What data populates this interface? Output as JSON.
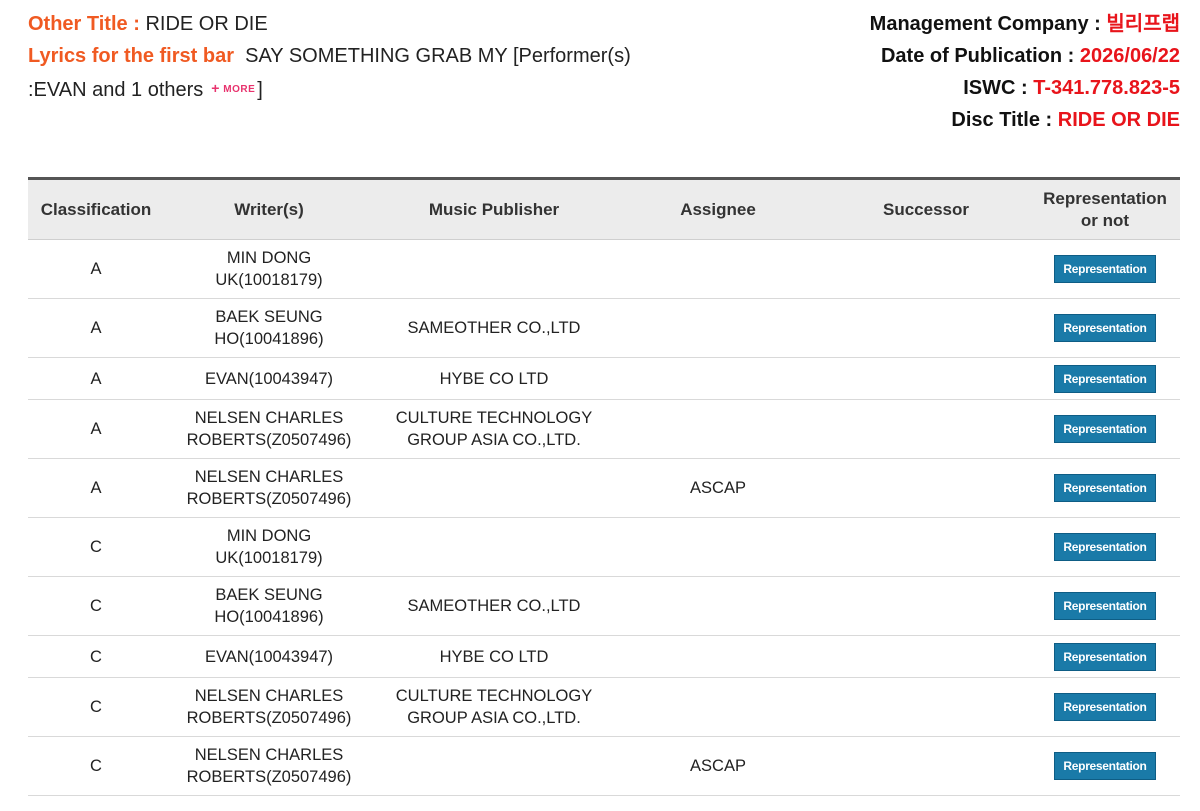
{
  "info": {
    "other_title_label": "Other Title :",
    "other_title_value": "RIDE OR DIE",
    "lyrics_label": "Lyrics for the first bar",
    "lyrics_value": "SAY SOMETHING GRAB MY [Performer(s)",
    "performers_value": ":EVAN and 1 others",
    "more_label": "MORE",
    "performers_close": "]"
  },
  "meta": {
    "management_label": "Management Company :",
    "management_value": "빌리프랩",
    "date_label": "Date of Publication :",
    "date_value": "2026/06/22",
    "iswc_label": "ISWC :",
    "iswc_value": "T-341.778.823-5",
    "disc_label": "Disc Title :",
    "disc_value": "RIDE OR DIE"
  },
  "table": {
    "headers": [
      "Classification",
      "Writer(s)",
      "Music Publisher",
      "Assignee",
      "Successor",
      "Representation or not"
    ],
    "rows": [
      {
        "classification": "A",
        "writer_line1": "MIN DONG",
        "writer_line2": "UK(10018179)",
        "publisher_line1": "",
        "publisher_line2": "",
        "assignee": "",
        "successor": "",
        "representation": "Representation"
      },
      {
        "classification": "A",
        "writer_line1": "BAEK SEUNG",
        "writer_line2": "HO(10041896)",
        "publisher_line1": "SAMEOTHER CO.,LTD",
        "publisher_line2": "",
        "assignee": "",
        "successor": "",
        "representation": "Representation"
      },
      {
        "classification": "A",
        "writer_line1": "EVAN(10043947)",
        "writer_line2": "",
        "publisher_line1": "HYBE CO LTD",
        "publisher_line2": "",
        "assignee": "",
        "successor": "",
        "representation": "Representation"
      },
      {
        "classification": "A",
        "writer_line1": "NELSEN CHARLES",
        "writer_line2": "ROBERTS(Z0507496)",
        "publisher_line1": "CULTURE TECHNOLOGY",
        "publisher_line2": "GROUP ASIA CO.,LTD.",
        "assignee": "",
        "successor": "",
        "representation": "Representation"
      },
      {
        "classification": "A",
        "writer_line1": "NELSEN CHARLES",
        "writer_line2": "ROBERTS(Z0507496)",
        "publisher_line1": "",
        "publisher_line2": "",
        "assignee": "ASCAP",
        "successor": "",
        "representation": "Representation"
      },
      {
        "classification": "C",
        "writer_line1": "MIN DONG",
        "writer_line2": "UK(10018179)",
        "publisher_line1": "",
        "publisher_line2": "",
        "assignee": "",
        "successor": "",
        "representation": "Representation"
      },
      {
        "classification": "C",
        "writer_line1": "BAEK SEUNG",
        "writer_line2": "HO(10041896)",
        "publisher_line1": "SAMEOTHER CO.,LTD",
        "publisher_line2": "",
        "assignee": "",
        "successor": "",
        "representation": "Representation"
      },
      {
        "classification": "C",
        "writer_line1": "EVAN(10043947)",
        "writer_line2": "",
        "publisher_line1": "HYBE CO LTD",
        "publisher_line2": "",
        "assignee": "",
        "successor": "",
        "representation": "Representation"
      },
      {
        "classification": "C",
        "writer_line1": "NELSEN CHARLES",
        "writer_line2": "ROBERTS(Z0507496)",
        "publisher_line1": "CULTURE TECHNOLOGY",
        "publisher_line2": "GROUP ASIA CO.,LTD.",
        "assignee": "",
        "successor": "",
        "representation": "Representation"
      },
      {
        "classification": "C",
        "writer_line1": "NELSEN CHARLES",
        "writer_line2": "ROBERTS(Z0507496)",
        "publisher_line1": "",
        "publisher_line2": "",
        "assignee": "ASCAP",
        "successor": "",
        "representation": "Representation"
      }
    ]
  }
}
